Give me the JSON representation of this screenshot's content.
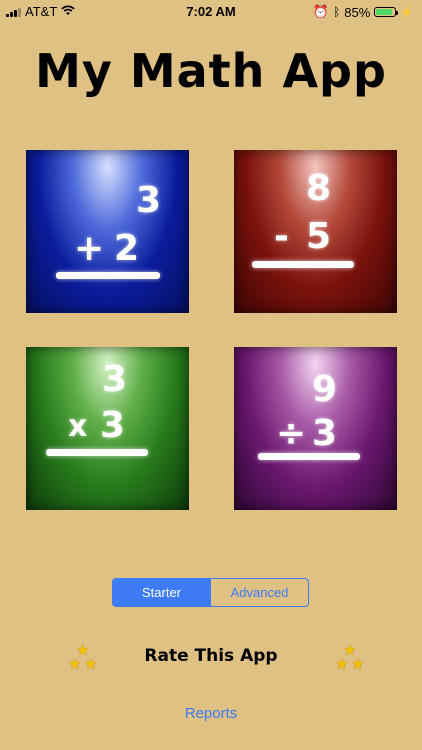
{
  "status_bar": {
    "carrier": "AT&T",
    "time": "7:02 AM",
    "battery": "85%",
    "icons": [
      "signal-bars",
      "wifi-icon",
      "alarm-icon",
      "bluetooth-icon",
      "battery-icon",
      "charging-icon"
    ]
  },
  "title": "My Math App",
  "tiles": [
    {
      "top": "3",
      "op": "+",
      "bottom": "2"
    },
    {
      "top": "8",
      "op": "-",
      "bottom": "5"
    },
    {
      "top": "3",
      "op": "x",
      "bottom": "3"
    },
    {
      "top": "9",
      "op": "÷",
      "bottom": "3"
    }
  ],
  "levels": {
    "starter": "Starter",
    "advanced": "Advanced",
    "selected": "Starter"
  },
  "rate": {
    "label": "Rate This App"
  },
  "reports": "Reports",
  "colors": {
    "background": "#e0c184",
    "accent": "#3d7bf7"
  }
}
